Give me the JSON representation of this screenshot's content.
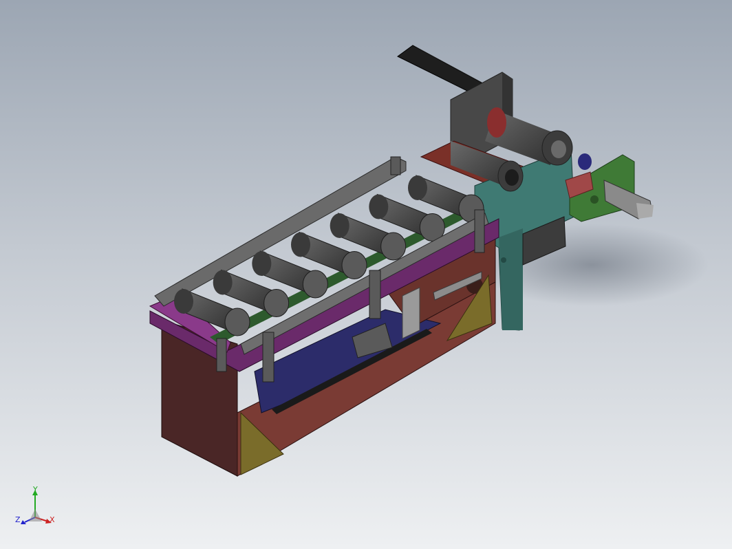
{
  "view": {
    "background_top": "#9ca6b3",
    "background_bottom": "#eef0f2"
  },
  "model": {
    "colors": {
      "frame_dark_red": "#5a2c2c",
      "base_red": "#7a3b34",
      "rail_purple": "#6a2a6a",
      "rail_gray": "#6a6a6a",
      "roller_gray": "#4e4e4e",
      "bracket_teal": "#3f7a73",
      "bracket_green": "#3f7a36",
      "plate_olive": "#7a6c2a",
      "slide_blue": "#2c2c6a",
      "cylinder_black": "#2a2a2a",
      "plate_red_right": "#a04848"
    },
    "roller_count": 7
  },
  "triad": {
    "y_label": "Y",
    "x_label": "X",
    "z_label": "Z",
    "y_color": "#22aa22",
    "x_color": "#cc2222",
    "z_color": "#2222cc"
  }
}
